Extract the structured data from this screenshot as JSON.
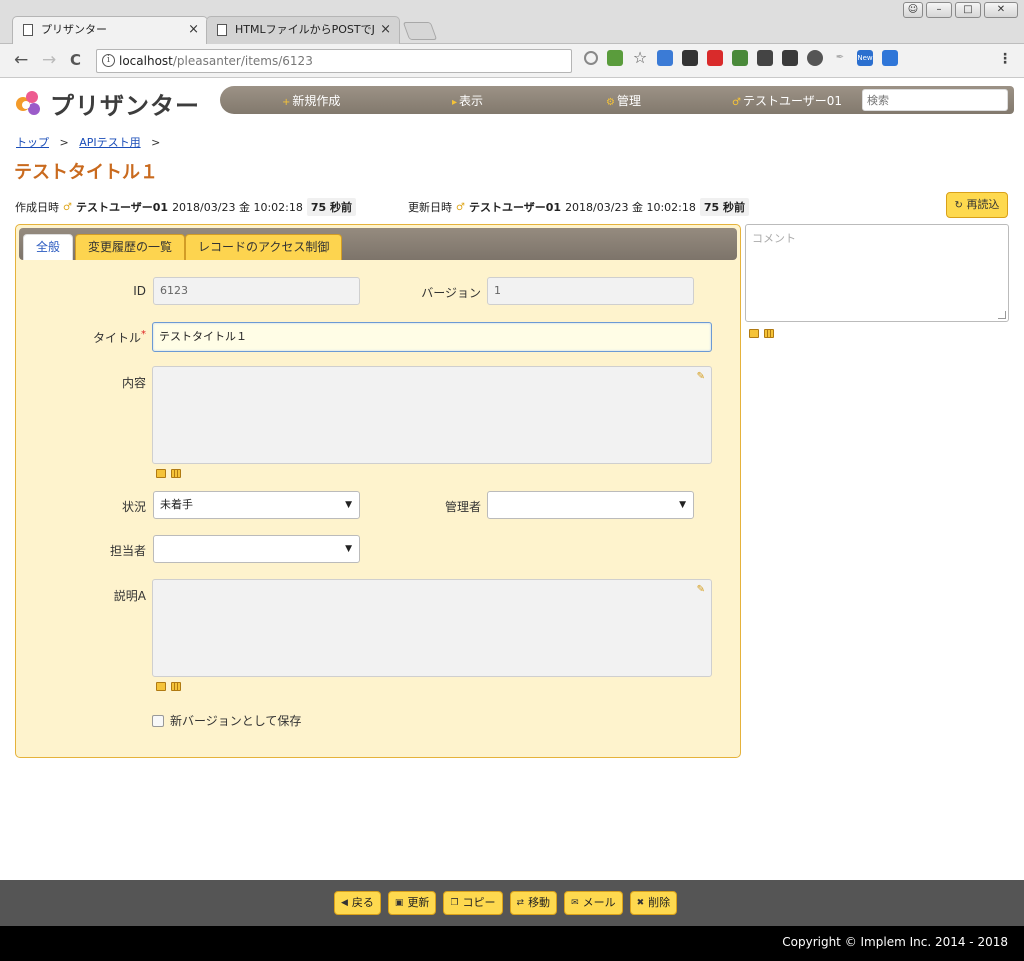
{
  "browser": {
    "tabs": [
      {
        "title": "プリザンター",
        "active": true
      },
      {
        "title": "HTMLファイルからPOSTでJ",
        "active": false
      }
    ],
    "url_host": "localhost",
    "url_path": "/pleasanter/items/6123",
    "back": "←",
    "forward": "→",
    "reload": "C",
    "close_glyph": "×"
  },
  "header": {
    "logo_text": "プリザンター",
    "menu": {
      "new_label": "新規作成",
      "view_label": "表示",
      "manage_label": "管理",
      "user_label": "テストユーザー01"
    },
    "search_placeholder": "検索"
  },
  "breadcrumb": {
    "top": "トップ",
    "site": "APIテスト用",
    "separator": ">"
  },
  "page_title": "テストタイトル１",
  "meta": {
    "created_label": "作成日時",
    "created_user": "テストユーザー01",
    "created_datetime": "2018/03/23 金 10:02:18",
    "created_elapsed": "75 秒前",
    "updated_label": "更新日時",
    "updated_user": "テストユーザー01",
    "updated_datetime": "2018/03/23 金 10:02:18",
    "updated_elapsed": "75 秒前",
    "reload_label": "再読込"
  },
  "editor": {
    "tabs": [
      "全般",
      "変更履歴の一覧",
      "レコードのアクセス制御"
    ],
    "fields": {
      "id_label": "ID",
      "id_value": "6123",
      "version_label": "バージョン",
      "version_value": "1",
      "title_label": "タイトル",
      "title_required": "*",
      "title_value": "テストタイトル１",
      "body_label": "内容",
      "status_label": "状況",
      "status_value": "未着手",
      "manager_label": "管理者",
      "manager_value": "",
      "owner_label": "担当者",
      "owner_value": "",
      "description_label": "説明A",
      "new_version_label": "新バージョンとして保存"
    }
  },
  "comment": {
    "placeholder": "コメント"
  },
  "actions": {
    "back": "戻る",
    "update": "更新",
    "copy": "コピー",
    "move": "移動",
    "mail": "メール",
    "delete": "削除"
  },
  "footer": {
    "copyright": "Copyright © Implem Inc. 2014 - 2018"
  },
  "colors": {
    "accent_yellow": "#fed94f",
    "title_orange": "#c96a1e",
    "panel_bg": "#fef3cd",
    "header_bar": "#8f867a"
  }
}
